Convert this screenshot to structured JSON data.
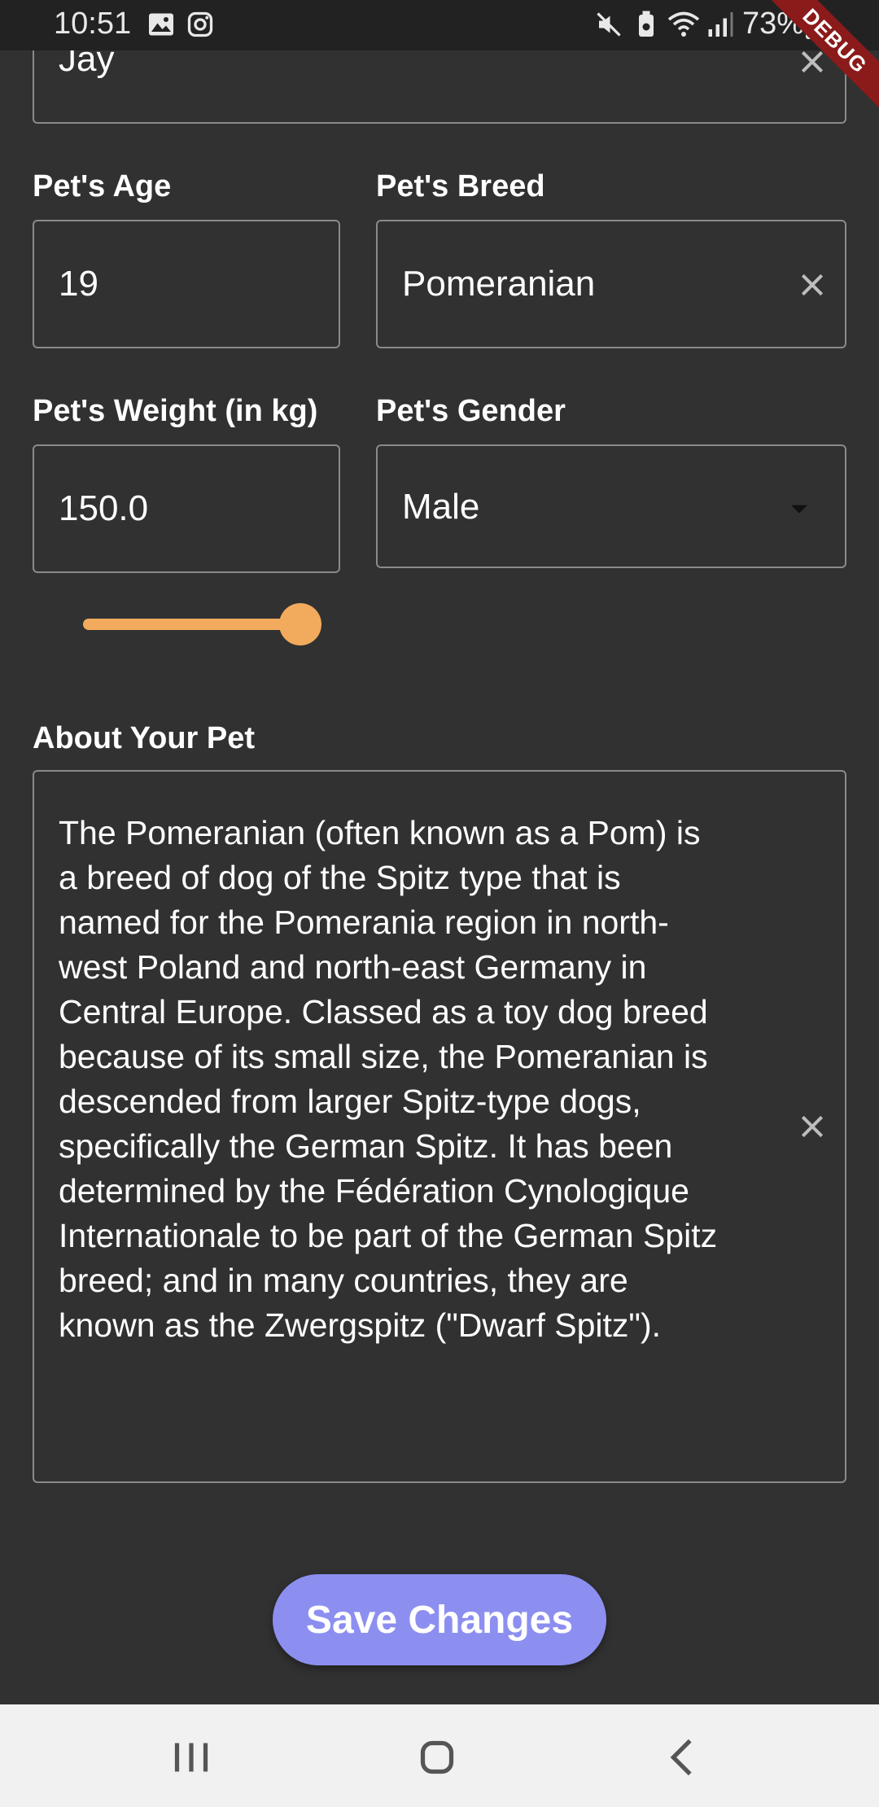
{
  "status_bar": {
    "time": "10:51",
    "battery": "73%",
    "debug": "DEBUG"
  },
  "form": {
    "name_value": "Jay",
    "age": {
      "label": "Pet's Age",
      "value": "19"
    },
    "breed": {
      "label": "Pet's Breed",
      "value": "Pomeranian"
    },
    "weight": {
      "label": "Pet's Weight (in kg)",
      "value": "150.0",
      "slider_fraction": 1.0
    },
    "gender": {
      "label": "Pet's Gender",
      "value": "Male"
    },
    "about": {
      "label": "About Your Pet",
      "value": "The Pomeranian (often known as a Pom) is a breed of dog of the Spitz type that is named for the Pomerania region in north-west Poland and north-east Germany in Central Europe. Classed as a toy dog breed because of its small size, the Pomeranian is descended from larger Spitz-type dogs, specifically the German Spitz. It has been determined by the Fédération Cynologique Internationale to be part of the German Spitz breed; and in many countries, they are known as the Zwergspitz (\"Dwarf Spitz\")."
    },
    "save_label": "Save Changes"
  },
  "colors": {
    "background": "#313131",
    "accent_slider": "#f2ab5c",
    "save_button": "#8c8ff0"
  }
}
